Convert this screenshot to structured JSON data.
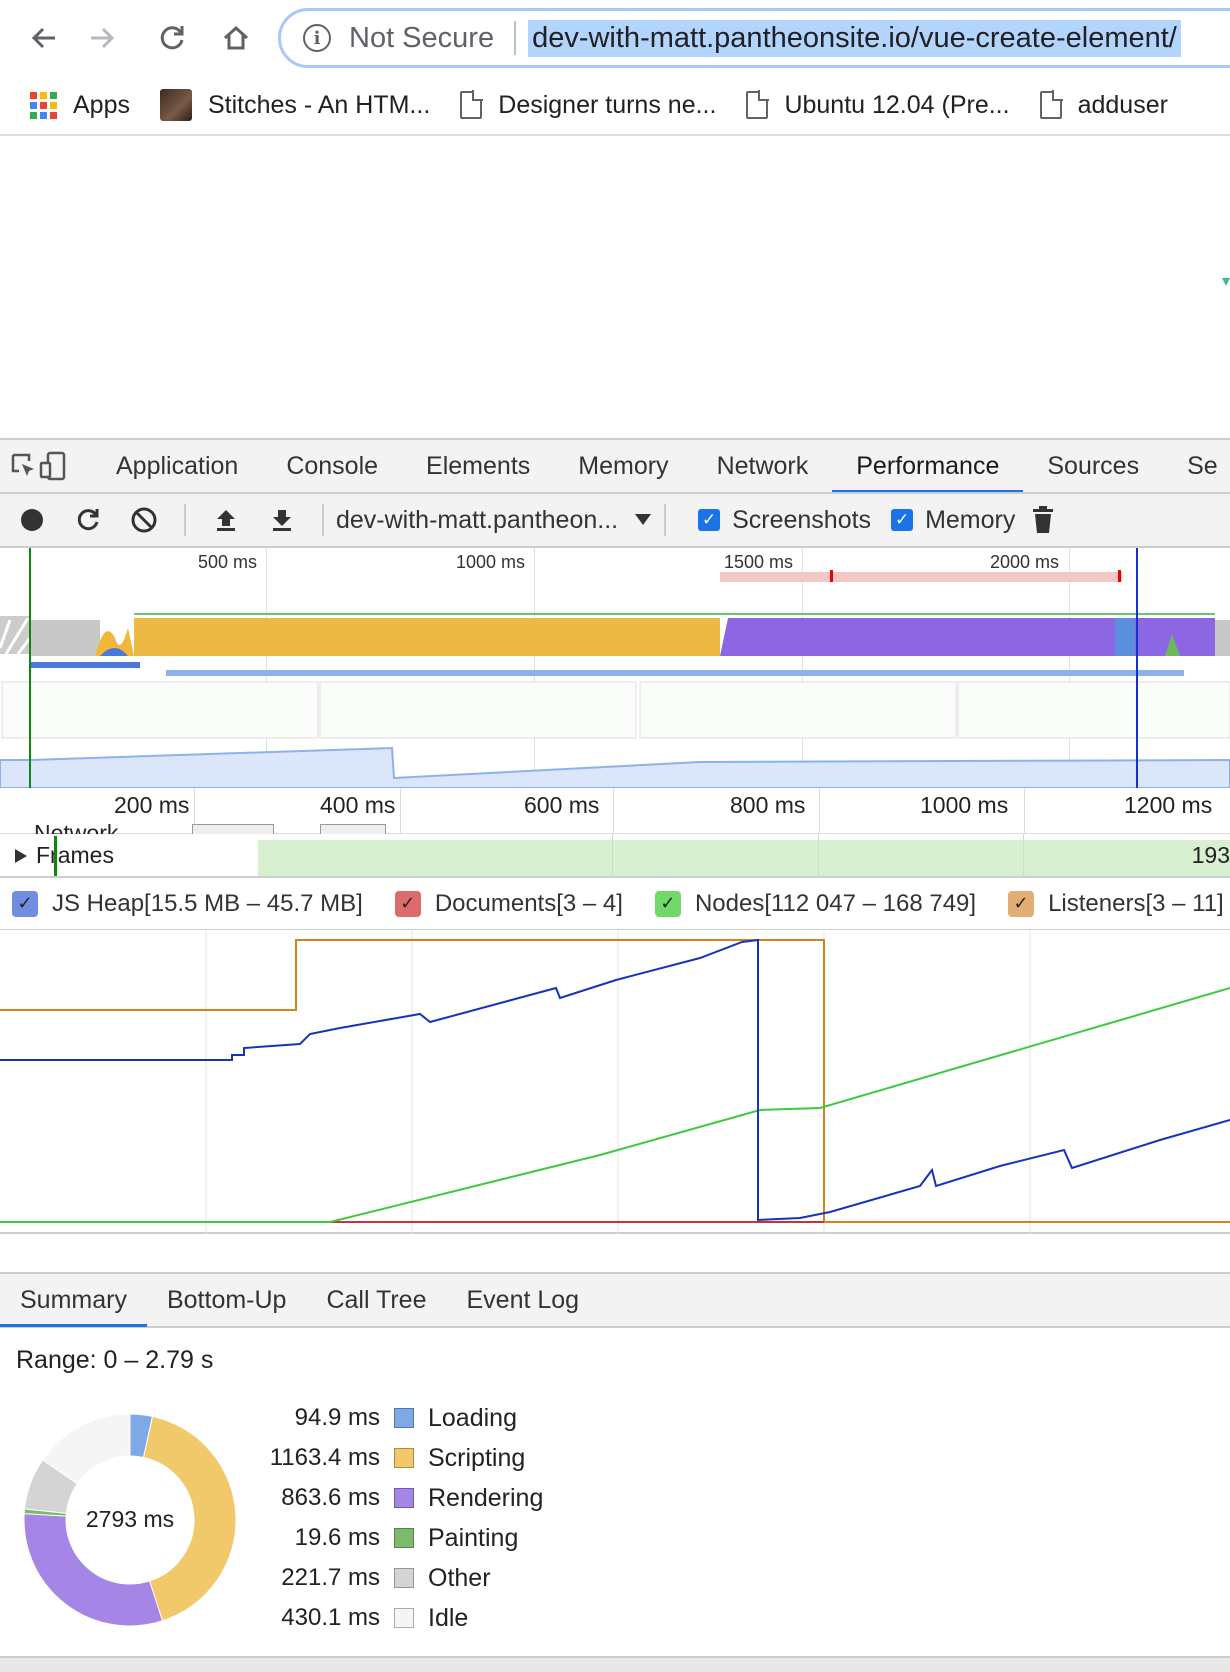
{
  "browser": {
    "security_label": "Not Secure",
    "url": "dev-with-matt.pantheonsite.io/vue-create-element/",
    "bookmarks": [
      {
        "label": "Apps",
        "icon": "apps-grid-icon"
      },
      {
        "label": "Stitches - An HTM...",
        "icon": "avatar-thumbnail"
      },
      {
        "label": "Designer turns ne...",
        "icon": "document-icon"
      },
      {
        "label": "Ubuntu 12.04 (Pre...",
        "icon": "document-icon"
      },
      {
        "label": "adduser",
        "icon": "document-icon"
      }
    ]
  },
  "devtools": {
    "tabs": [
      "Application",
      "Console",
      "Elements",
      "Memory",
      "Network",
      "Performance",
      "Sources",
      "Se"
    ],
    "active_tab": "Performance",
    "profile_select": "dev-with-matt.pantheon...",
    "screenshots_label": "Screenshots",
    "memory_label": "Memory",
    "screenshots_checked": true,
    "memory_checked": true
  },
  "overview": {
    "ticks": [
      "500 ms",
      "1000 ms",
      "1500 ms",
      "2000 ms"
    ]
  },
  "timeline": {
    "ticks": [
      "200 ms",
      "400 ms",
      "600 ms",
      "800 ms",
      "1000 ms",
      "1200 ms"
    ],
    "network_label": "Network",
    "frames_label": "Frames",
    "frames_count": "193"
  },
  "counters": [
    {
      "label": "JS Heap[15.5 MB – 45.7 MB]",
      "color": "#4a6bd1"
    },
    {
      "label": "Documents[3 – 4]",
      "color": "#d9534f"
    },
    {
      "label": "Nodes[112 047 – 168 749]",
      "color": "#4cd14c"
    },
    {
      "label": "Listeners[3 – 11]",
      "color": "#d9a05f"
    },
    {
      "label": "",
      "color": "#c95bd6"
    }
  ],
  "summary": {
    "tabs": [
      "Summary",
      "Bottom-Up",
      "Call Tree",
      "Event Log"
    ],
    "active_tab": "Summary",
    "range": "Range: 0 – 2.79 s",
    "total": "2793 ms",
    "items": [
      {
        "value": "94.9 ms",
        "name": "Loading",
        "color": "#7fa9e6",
        "ms": 94.9
      },
      {
        "value": "1163.4 ms",
        "name": "Scripting",
        "color": "#f1c96b",
        "ms": 1163.4
      },
      {
        "value": "863.6 ms",
        "name": "Rendering",
        "color": "#a585e6",
        "ms": 863.6
      },
      {
        "value": "19.6 ms",
        "name": "Painting",
        "color": "#7cbb6e",
        "ms": 19.6
      },
      {
        "value": "221.7 ms",
        "name": "Other",
        "color": "#d4d4d4",
        "ms": 221.7
      },
      {
        "value": "430.1 ms",
        "name": "Idle",
        "color": "#f5f5f5",
        "ms": 430.1
      }
    ]
  }
}
